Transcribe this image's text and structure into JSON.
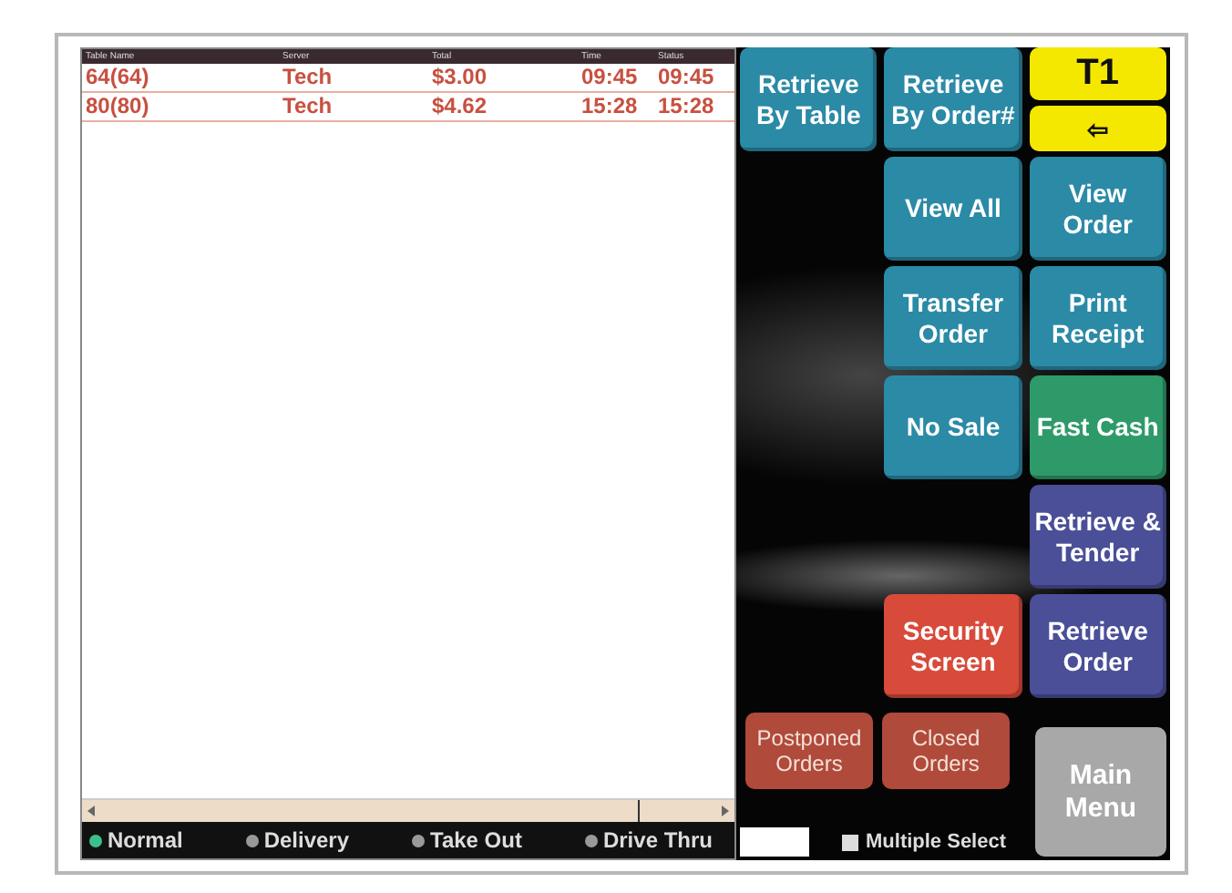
{
  "table": {
    "columns": [
      "Table Name",
      "Server",
      "Total",
      "Time",
      "Status"
    ],
    "rows": [
      [
        "64(64)",
        "Tech",
        "$3.00",
        "09:45",
        "09:45"
      ],
      [
        "80(80)",
        "Tech",
        "$4.62",
        "15:28",
        "15:28"
      ]
    ]
  },
  "order_types": [
    {
      "label": "Normal",
      "selected": true
    },
    {
      "label": "Delivery",
      "selected": false
    },
    {
      "label": "Take Out",
      "selected": false
    },
    {
      "label": "Drive Thru",
      "selected": false
    }
  ],
  "buttons": [
    {
      "label": "Retrieve By Table",
      "color": "#2b8aa6"
    },
    {
      "label": "Retrieve By Order#",
      "color": "#2b8aa6"
    },
    {
      "label": "View All",
      "color": "#2b8aa6"
    },
    {
      "label": "View Order",
      "color": "#2b8aa6"
    },
    {
      "label": "Transfer Order",
      "color": "#2b8aa6"
    },
    {
      "label": "Print Receipt",
      "color": "#2b8aa6"
    },
    {
      "label": "No Sale",
      "color": "#2b8aa6"
    },
    {
      "label": "Fast Cash",
      "color": "#2e9a6a"
    },
    {
      "label": "Retrieve & Tender",
      "color": "#4a4f98"
    },
    {
      "label": "Security Screen",
      "color": "#d84a3a"
    },
    {
      "label": "Retrieve Order",
      "color": "#4a4f98"
    }
  ],
  "terminal": {
    "label": "T1",
    "back": "⇦"
  },
  "small_buttons": [
    {
      "label": "Postponed Orders"
    },
    {
      "label": "Closed Orders"
    }
  ],
  "main_menu": "Main Menu",
  "multiple_select": {
    "label": "Multiple Select",
    "checked": false
  }
}
